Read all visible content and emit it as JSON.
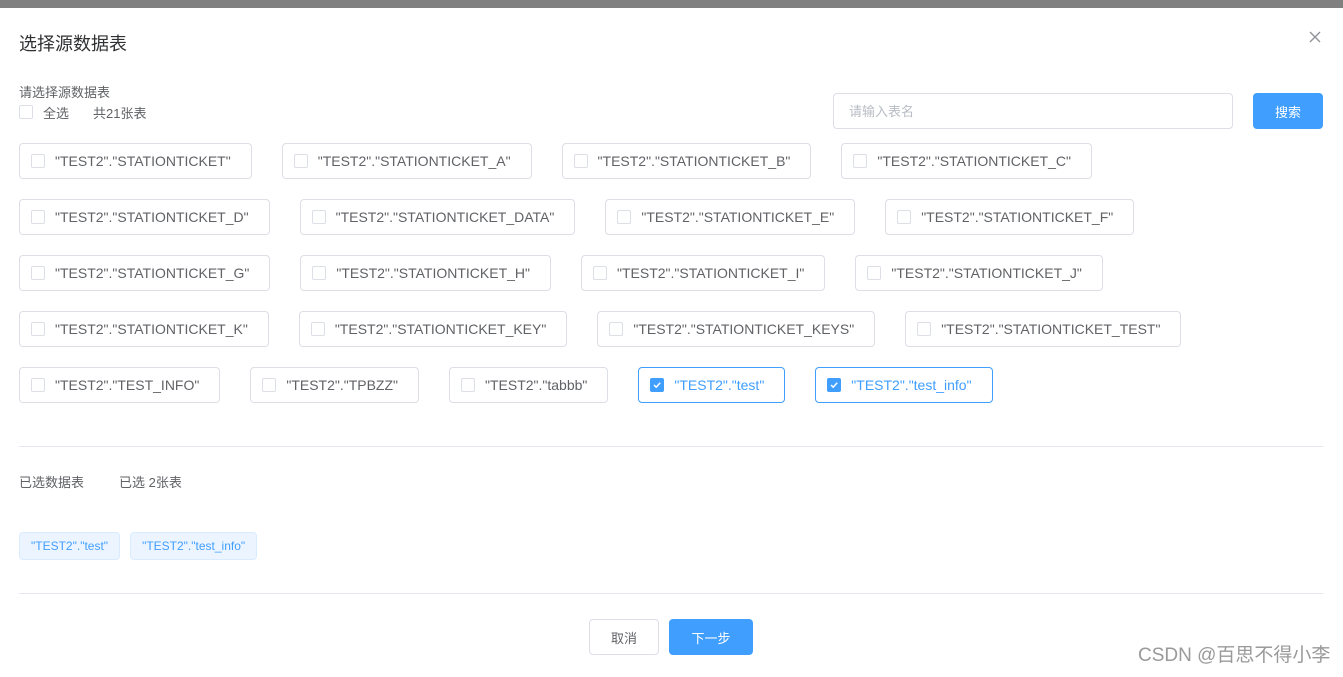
{
  "dialog": {
    "title": "选择源数据表",
    "close_icon": "close-icon"
  },
  "source": {
    "label": "请选择源数据表",
    "select_all_label": "全选",
    "select_all_checked": false,
    "total_text": "共21张表"
  },
  "search": {
    "placeholder": "请输入表名",
    "value": "",
    "button_label": "搜索"
  },
  "tables": [
    [
      {
        "label": "\"TEST2\".\"STATIONTICKET\"",
        "checked": false
      },
      {
        "label": "\"TEST2\".\"STATIONTICKET_A\"",
        "checked": false
      },
      {
        "label": "\"TEST2\".\"STATIONTICKET_B\"",
        "checked": false
      },
      {
        "label": "\"TEST2\".\"STATIONTICKET_C\"",
        "checked": false
      }
    ],
    [
      {
        "label": "\"TEST2\".\"STATIONTICKET_D\"",
        "checked": false
      },
      {
        "label": "\"TEST2\".\"STATIONTICKET_DATA\"",
        "checked": false
      },
      {
        "label": "\"TEST2\".\"STATIONTICKET_E\"",
        "checked": false
      },
      {
        "label": "\"TEST2\".\"STATIONTICKET_F\"",
        "checked": false
      }
    ],
    [
      {
        "label": "\"TEST2\".\"STATIONTICKET_G\"",
        "checked": false
      },
      {
        "label": "\"TEST2\".\"STATIONTICKET_H\"",
        "checked": false
      },
      {
        "label": "\"TEST2\".\"STATIONTICKET_I\"",
        "checked": false
      },
      {
        "label": "\"TEST2\".\"STATIONTICKET_J\"",
        "checked": false
      }
    ],
    [
      {
        "label": "\"TEST2\".\"STATIONTICKET_K\"",
        "checked": false
      },
      {
        "label": "\"TEST2\".\"STATIONTICKET_KEY\"",
        "checked": false
      },
      {
        "label": "\"TEST2\".\"STATIONTICKET_KEYS\"",
        "checked": false
      },
      {
        "label": "\"TEST2\".\"STATIONTICKET_TEST\"",
        "checked": false
      }
    ],
    [
      {
        "label": "\"TEST2\".\"TEST_INFO\"",
        "checked": false
      },
      {
        "label": "\"TEST2\".\"TPBZZ\"",
        "checked": false
      },
      {
        "label": "\"TEST2\".\"tabbb\"",
        "checked": false
      },
      {
        "label": "\"TEST2\".\"test\"",
        "checked": true
      },
      {
        "label": "\"TEST2\".\"test_info\"",
        "checked": true
      }
    ]
  ],
  "selected": {
    "label": "已选数据表",
    "count_text": "已选 2张表",
    "tags": [
      "\"TEST2\".\"test\"",
      "\"TEST2\".\"test_info\""
    ]
  },
  "footer": {
    "cancel_label": "取消",
    "next_label": "下一步"
  },
  "watermark": "CSDN @百思不得小李",
  "colors": {
    "primary": "#409eff",
    "border": "#dcdfe6",
    "text": "#606266",
    "tag_bg": "#ecf5ff"
  }
}
